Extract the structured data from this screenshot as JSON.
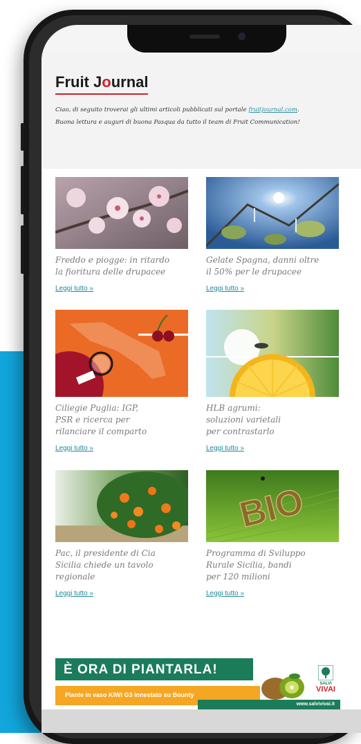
{
  "newsletter": {
    "logo": {
      "part1": "Fruit J",
      "accent": "o",
      "part2": "urnal"
    },
    "intro_before_link": "Ciao, di seguito troverai gli ultimi articoli pubblicati sul portale ",
    "intro_link": "fruitjournal.com",
    "intro_after_link": ".",
    "intro_line2": "Buona lettura e auguri di buona Pasqua da tutto il team di Fruit Communication!"
  },
  "articles": [
    {
      "title_l1": "Freddo e piogge: in ritardo",
      "title_l2": "la fioritura delle drupacee",
      "title_l3": "",
      "read_more": "Leggi tutto »"
    },
    {
      "title_l1": "Gelate Spagna, danni oltre",
      "title_l2": "il 50% per le drupacee",
      "title_l3": "",
      "read_more": "Leggi tutto »"
    },
    {
      "title_l1": "Ciliegie Puglia: IGP,",
      "title_l2": "PSR e ricerca per",
      "title_l3": "rilanciare il comparto",
      "read_more": "Leggi tutto »"
    },
    {
      "title_l1": "HLB agrumi:",
      "title_l2": "soluzioni varietali",
      "title_l3": "per contrastarlo",
      "read_more": "Leggi tutto »"
    },
    {
      "title_l1": "Pac, il presidente di Cia",
      "title_l2": "Sicilia chiede un tavolo",
      "title_l3": "regionale",
      "read_more": "Leggi tutto »"
    },
    {
      "title_l1": "Programma di Sviluppo",
      "title_l2": "Rurale Sicilia, bandi",
      "title_l3": "per 120 milioni",
      "read_more": "Leggi tutto »"
    }
  ],
  "banner": {
    "headline": "È ORA DI PIANTARLA!",
    "subline": "Piante in vaso KIWI G3 innestato su Bounty",
    "brand_line1": "SALVI",
    "brand_line2": "VIVAI",
    "url": "www.salvivivai.it"
  },
  "images": {
    "image1_word": "BIO"
  },
  "colors": {
    "accent_red": "#d21f27",
    "link_teal": "#1f8a99",
    "banner_green": "#1b7c5a",
    "banner_orange": "#f5a623",
    "background_blue": "#12a6dc"
  }
}
